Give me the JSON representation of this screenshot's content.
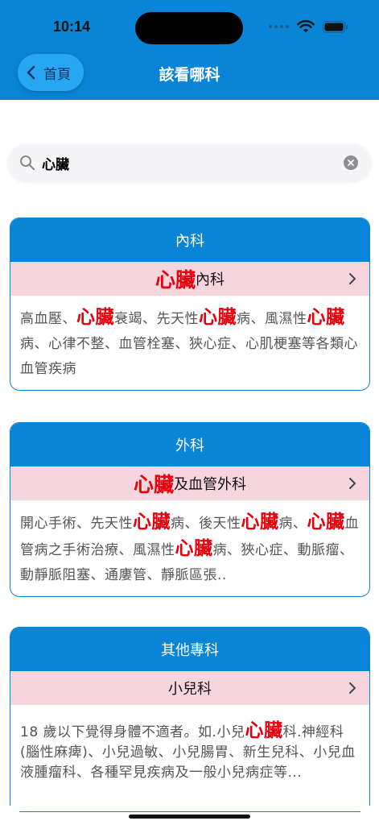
{
  "status": {
    "time": "10:14"
  },
  "nav": {
    "back_label": "首頁",
    "title": "該看哪科"
  },
  "search": {
    "value": "心臟",
    "placeholder": ""
  },
  "colors": {
    "primary": "#0A84D6",
    "highlight": "#E8000D",
    "row_bg": "#F5D5DE"
  },
  "cards": [
    {
      "header": "內科",
      "row": {
        "hl": "心臟",
        "suffix": "內科"
      },
      "desc": [
        {
          "t": "高血壓、"
        },
        {
          "t": "心臟",
          "hl": true
        },
        {
          "t": "衰竭、先天性"
        },
        {
          "t": "心臟",
          "hl": true
        },
        {
          "t": "病、風濕性"
        },
        {
          "t": "心臟",
          "hl": true
        },
        {
          "t": "病、心律不整、血管栓塞、狹心症、心肌梗塞等各類心血管疾病"
        }
      ]
    },
    {
      "header": "外科",
      "row": {
        "hl": "心臟",
        "suffix": "及血管外科"
      },
      "desc": [
        {
          "t": "開心手術、先天性"
        },
        {
          "t": "心臟",
          "hl": true
        },
        {
          "t": "病、後天性"
        },
        {
          "t": "心臟",
          "hl": true
        },
        {
          "t": "病、"
        },
        {
          "t": "心臟",
          "hl": true
        },
        {
          "t": "血管病之手術治療、風濕性"
        },
        {
          "t": "心臟",
          "hl": true
        },
        {
          "t": "病、狹心症、動脈瘤、動靜脈阻塞、通廔管、靜脈區張.."
        }
      ]
    },
    {
      "header": "其他專科",
      "row": {
        "hl": "",
        "suffix": "小兒科"
      },
      "desc": [
        {
          "t": "18 歲以下覺得身體不適者。如.小兒"
        },
        {
          "t": "心臟",
          "hl": true
        },
        {
          "t": "科.神經科 (腦性麻痺)、小兒過敏、小兒腸胃、新生兒科、小兒血液腫瘤科、各種罕見疾病及一般小兒病症等..."
        }
      ]
    }
  ]
}
